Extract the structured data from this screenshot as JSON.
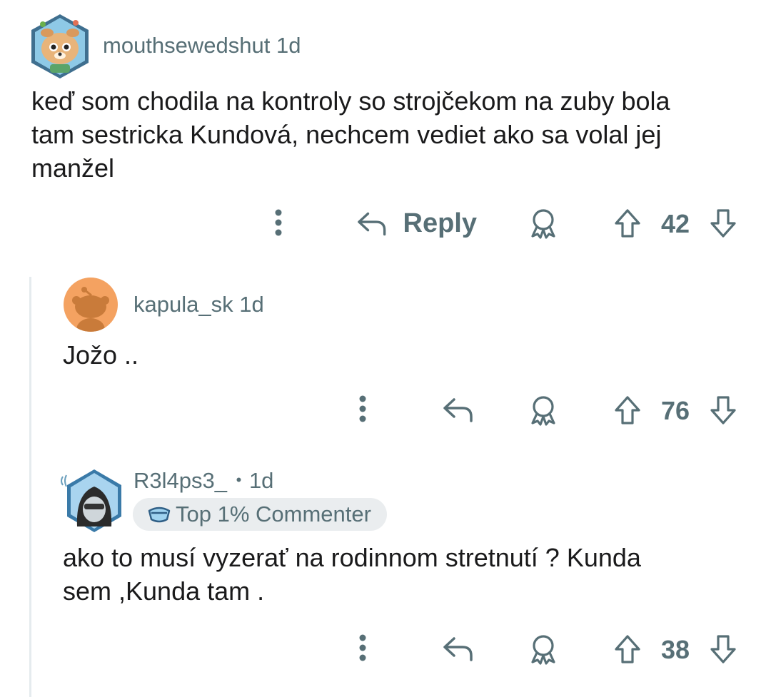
{
  "comments": [
    {
      "username": "mouthsewedshut",
      "age": "1d",
      "body_lines": [
        "keď som chodila na kontroly so strojčekom na zuby bola",
        "tam sestricka Kundová, nechcem vediet ako sa volal jej",
        "manžel"
      ],
      "reply_label": "Reply",
      "votes": "42"
    },
    {
      "username": "kapula_sk",
      "age": "1d",
      "body_lines": [
        "Jožo .."
      ],
      "votes": "76"
    },
    {
      "username": "R3l4ps3_",
      "separator": "•",
      "age": "1d",
      "badge": "Top 1% Commenter",
      "body_lines": [
        "ako to musí vyzerať na rodinnom stretnutí ? Kunda",
        "sem ,Kunda tam ."
      ],
      "votes": "38"
    }
  ],
  "colors": {
    "meta_text": "#576f76",
    "body_text": "#1a1a1b",
    "thread_line": "#e5ebee",
    "badge_bg": "#eaedef",
    "avatar_orange": "#f4a261"
  },
  "icons": [
    "overflow-dots-icon",
    "reply-arrow-icon",
    "award-icon",
    "upvote-arrow-icon",
    "downvote-arrow-icon",
    "shades-badge-icon"
  ]
}
